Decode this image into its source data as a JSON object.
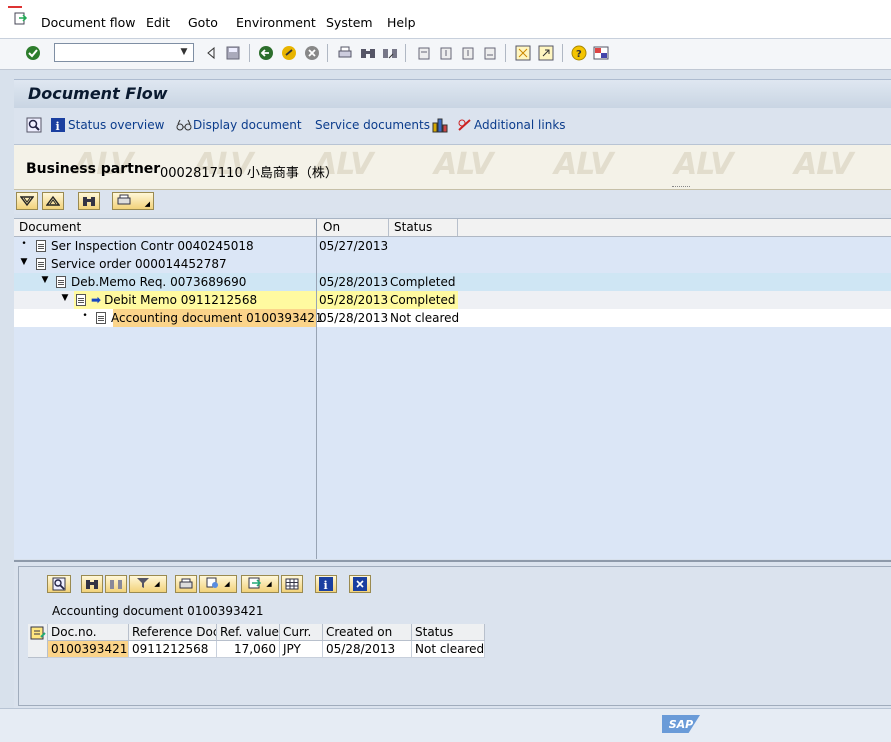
{
  "menu": {
    "items": [
      "Document flow",
      "Edit",
      "Goto",
      "Environment",
      "System",
      "Help"
    ]
  },
  "toolbar": {
    "command_value": "",
    "icons": [
      "enter-icon",
      "dropdown-icon",
      "back-triangle-icon",
      "save-icon",
      "back-icon",
      "exit-icon",
      "cancel-icon",
      "print-icon",
      "find-icon",
      "find-next-icon",
      "first-page-icon",
      "previous-page-icon",
      "next-page-icon",
      "last-page-icon",
      "new-session-icon",
      "shortcut-icon",
      "help-icon",
      "layout-icon"
    ]
  },
  "title": "Document Flow",
  "app_toolbar": {
    "status_overview": "Status overview",
    "display_document": "Display document",
    "service_documents": "Service documents",
    "additional_links": "Additional links"
  },
  "header": {
    "bp_label": "Business partner",
    "bp_value": "0002817110 小島商事（株）",
    "watermark": "ALV"
  },
  "tree": {
    "columns": [
      "Document",
      "On",
      "Status"
    ],
    "rows": [
      {
        "doc": "Ser Inspection Contr 0040245018",
        "on": "05/27/2013",
        "status": ""
      },
      {
        "doc": "Service order 000014452787",
        "on": "",
        "status": ""
      },
      {
        "doc": "Deb.Memo Req. 0073689690",
        "on": "05/28/2013",
        "status": "Completed"
      },
      {
        "doc": "Debit Memo 0911212568",
        "on": "05/28/2013",
        "status": "Completed"
      },
      {
        "doc": "Accounting document 0100393421",
        "on": "05/28/2013",
        "status": "Not cleared"
      }
    ]
  },
  "detail": {
    "title": "Accounting document 0100393421",
    "columns": [
      "Doc.no.",
      "Reference Doc",
      "Ref. value",
      "Curr.",
      "Created on",
      "Status"
    ],
    "row": [
      "0100393421",
      "0911212568",
      "17,060",
      "JPY",
      "05/28/2013",
      "Not cleared"
    ]
  },
  "status": {
    "logo": "SAP"
  },
  "colors": {
    "highlight_yellow": "#fffaa0",
    "highlight_orange": "#fbd48a",
    "selected_row": "#cfe6f4",
    "link_blue": "#0b3c8c"
  }
}
